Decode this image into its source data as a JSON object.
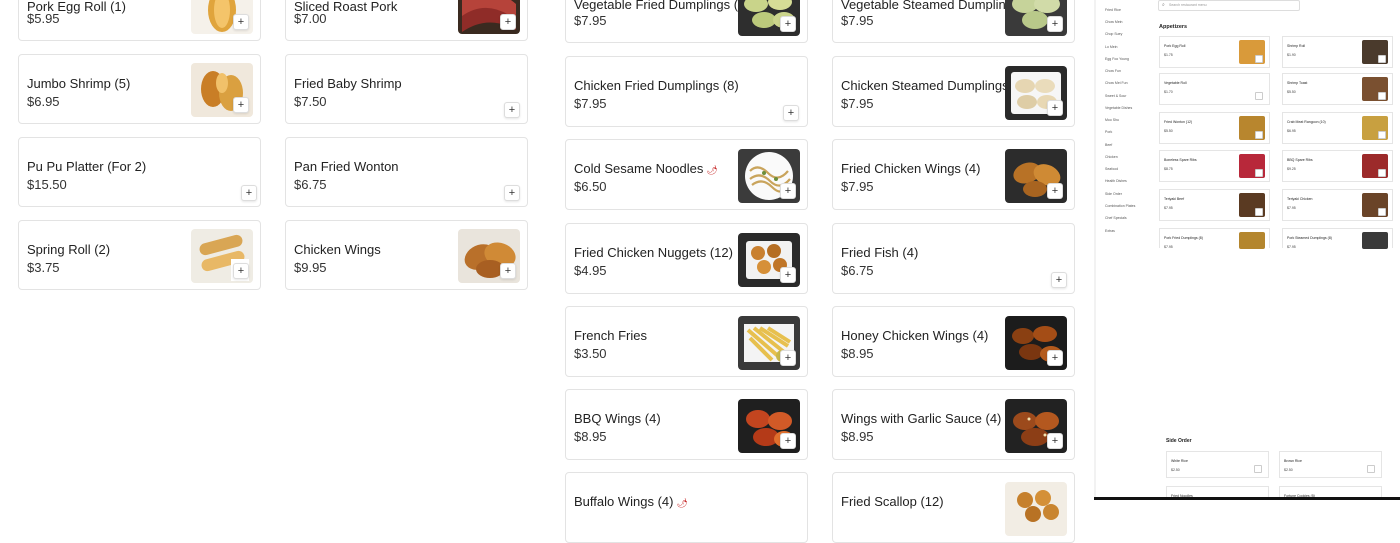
{
  "menu": {
    "items": [
      {
        "name": "Pork Egg Roll (1)",
        "price": "$5.95"
      },
      {
        "name": "Jumbo Shrimp (5)",
        "price": "$6.95"
      },
      {
        "name": "Pu Pu Platter (For 2)",
        "price": "$15.50"
      },
      {
        "name": "Spring Roll (2)",
        "price": "$3.75"
      },
      {
        "name": "Sliced Roast Pork",
        "price": "$7.00"
      },
      {
        "name": "Fried Baby Shrimp",
        "price": "$7.50"
      },
      {
        "name": "Pan Fried Wonton",
        "price": "$6.75"
      },
      {
        "name": "Chicken Wings",
        "price": "$9.95"
      },
      {
        "name": "Vegetable Fried Dumplings (8)",
        "price": "$7.95"
      },
      {
        "name": "Chicken Fried Dumplings (8)",
        "price": "$7.95"
      },
      {
        "name": "Cold Sesame Noodles",
        "price": "$6.50",
        "spicy": true
      },
      {
        "name": "Fried Chicken Nuggets (12)",
        "price": "$4.95"
      },
      {
        "name": "French Fries",
        "price": "$3.50"
      },
      {
        "name": "BBQ Wings (4)",
        "price": "$8.95"
      },
      {
        "name": "Buffalo Wings (4)",
        "price": "",
        "spicy": true
      },
      {
        "name": "Vegetable Steamed Dumplings (8)",
        "price": "$7.95"
      },
      {
        "name": "Chicken Steamed Dumplings (8)",
        "price": "$7.95"
      },
      {
        "name": "Fried Chicken Wings (4)",
        "price": "$7.95"
      },
      {
        "name": "Fried Fish (4)",
        "price": "$6.75"
      },
      {
        "name": "Honey Chicken Wings (4)",
        "price": "$8.95"
      },
      {
        "name": "Wings with Garlic Sauce (4)",
        "price": "$8.95",
        "spicy": true
      },
      {
        "name": "Fried Scallop (12)",
        "price": ""
      }
    ],
    "add_label": "+",
    "chili_icon": "chili-pepper-icon"
  },
  "mini": {
    "search_placeholder": "Search restaurant menu",
    "nav": [
      "Fried Rice",
      "Chow Mein",
      "Chop Suey",
      "Lo Mein",
      "Egg Foo Young",
      "Chow Fun",
      "Chow Mei Fun",
      "Sweet & Sour",
      "Vegetable Dishes",
      "Moo Shu",
      "Pork",
      "Beef",
      "Chicken",
      "Seafood",
      "Health Dishes",
      "Side Order",
      "Combination Plates",
      "Chef Specials",
      "Extras"
    ],
    "section_title": "Appetizers",
    "items": [
      {
        "name": "Pork Egg Roll",
        "price": "$1.75"
      },
      {
        "name": "Shrimp Roll",
        "price": "$1.90"
      },
      {
        "name": "Vegetable Roll",
        "price": "$1.70"
      },
      {
        "name": "Shrimp Toast",
        "price": "$5.50"
      },
      {
        "name": "Fried Wonton (12)",
        "price": "$5.50"
      },
      {
        "name": "Crab Meat Rangoon (10)",
        "price": "$6.95"
      },
      {
        "name": "Boneless Spare Ribs",
        "price": "$8.75"
      },
      {
        "name": "BBQ Spare Ribs",
        "price": "$9.25"
      },
      {
        "name": "Teriyaki Beef",
        "price": "$7.95"
      },
      {
        "name": "Teriyaki Chicken",
        "price": "$7.95"
      },
      {
        "name": "Pork Fried Dumplings (8)",
        "price": "$7.95"
      },
      {
        "name": "Pork Steamed Dumplings (8)",
        "price": "$7.95"
      }
    ],
    "side_title": "Side Order",
    "side_items": [
      {
        "name": "White Rice",
        "price": "$2.50"
      },
      {
        "name": "Brown Rice",
        "price": "$2.50"
      },
      {
        "name": "Fried Noodles",
        "price": ""
      },
      {
        "name": "Fortune Cookies (5)",
        "price": ""
      }
    ]
  }
}
